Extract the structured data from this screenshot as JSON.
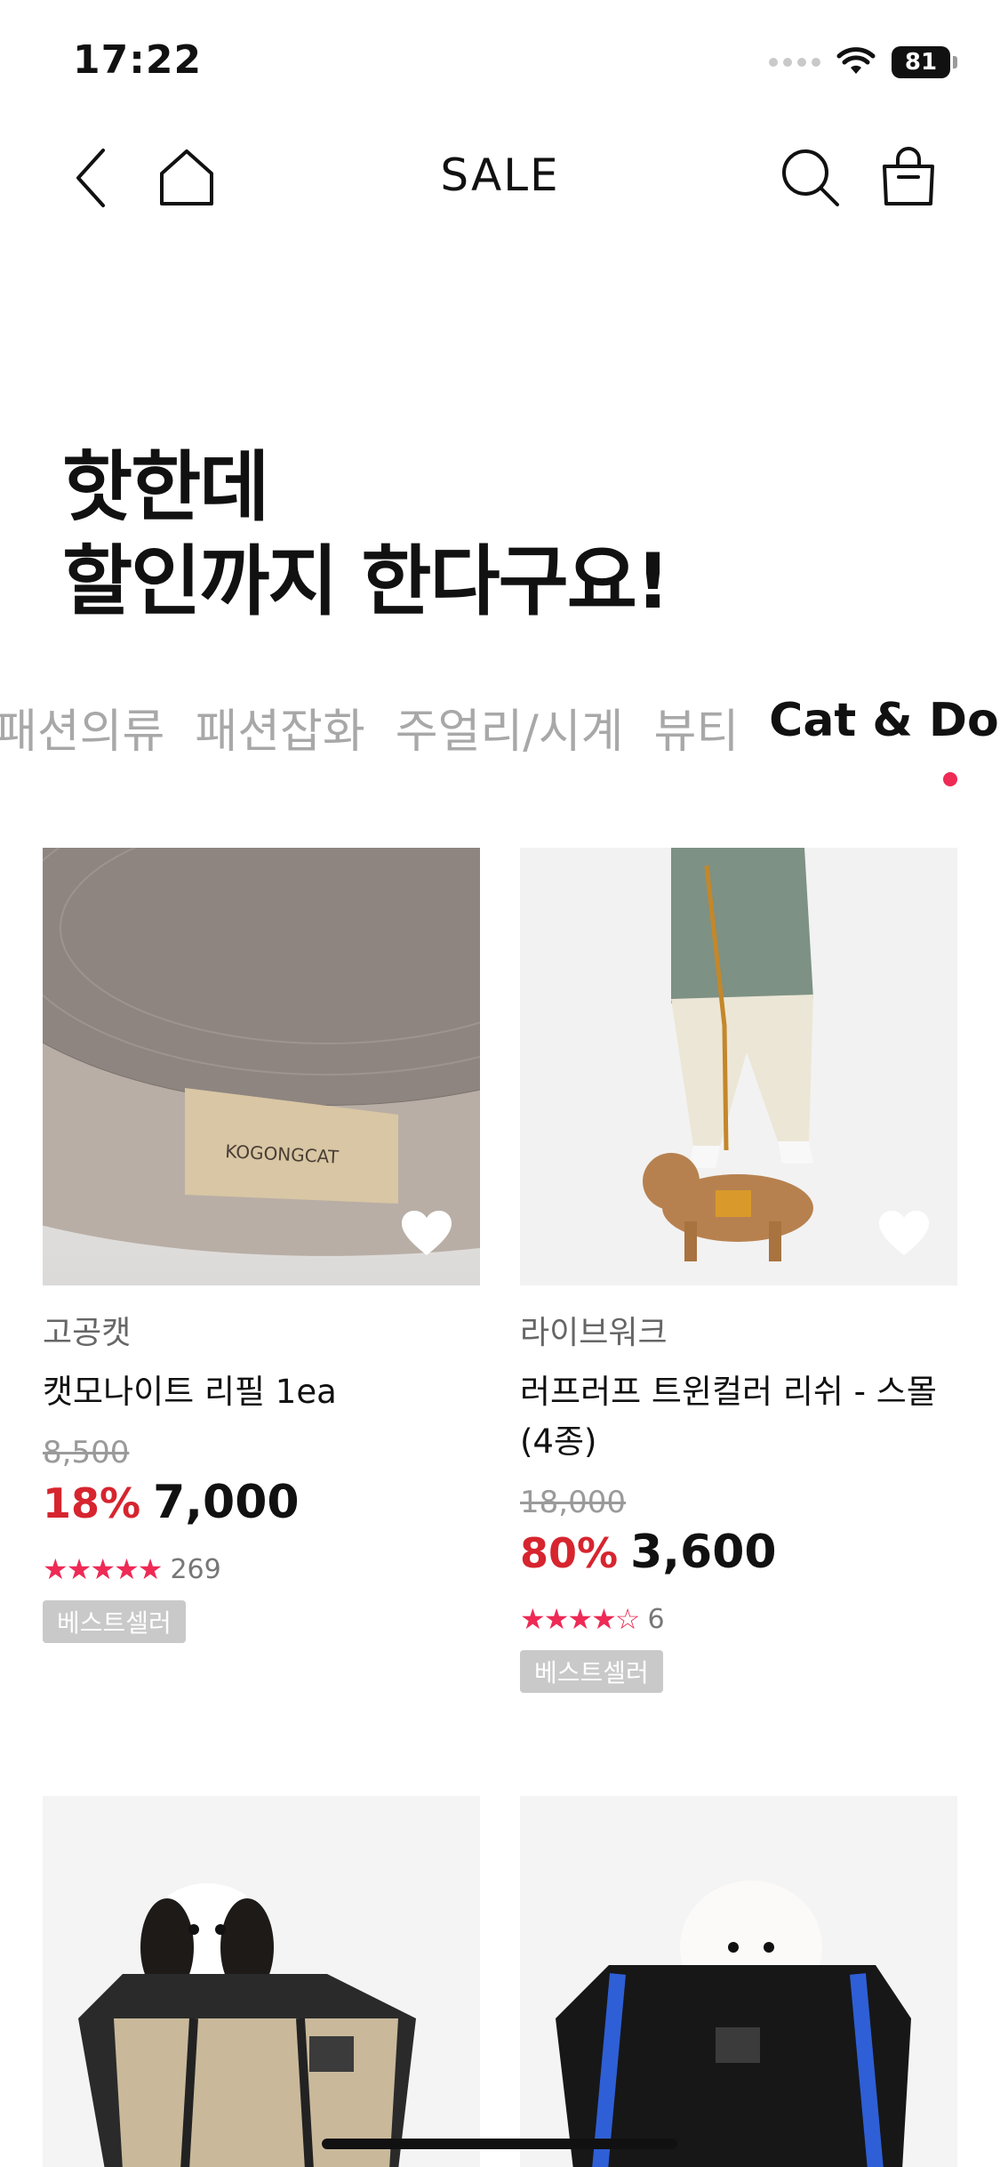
{
  "status_bar": {
    "time": "17:22",
    "battery": "81"
  },
  "nav": {
    "title": "SALE",
    "icons": [
      "back-icon",
      "home-icon",
      "search-icon",
      "shopping-bag-icon"
    ]
  },
  "headline": {
    "line1": "핫한데",
    "line2": "할인까지 한다구요!"
  },
  "tabs": [
    {
      "label": "패션의류",
      "active": false
    },
    {
      "label": "패션잡화",
      "active": false
    },
    {
      "label": "주얼리/시계",
      "active": false
    },
    {
      "label": "뷰티",
      "active": false
    },
    {
      "label": "Cat & Dog",
      "active": true
    }
  ],
  "products": [
    {
      "brand": "고공캣",
      "name": "캣모나이트 리필 1ea",
      "original_price": "8,500",
      "discount": "18%",
      "price": "7,000",
      "rating": 5,
      "review_count": "269",
      "badge": "베스트셀러",
      "image_text": "KOGONGCAT"
    },
    {
      "brand": "라이브워크",
      "name": "러프러프 트윈컬러 리쉬 - 스몰 (4종)",
      "original_price": "18,000",
      "discount": "80%",
      "price": "3,600",
      "rating": 4.5,
      "review_count": "6",
      "badge": "베스트셀러"
    }
  ],
  "colors": {
    "accent": "#ee2a55",
    "discount": "#d6252f",
    "muted": "#a8a8a8"
  }
}
